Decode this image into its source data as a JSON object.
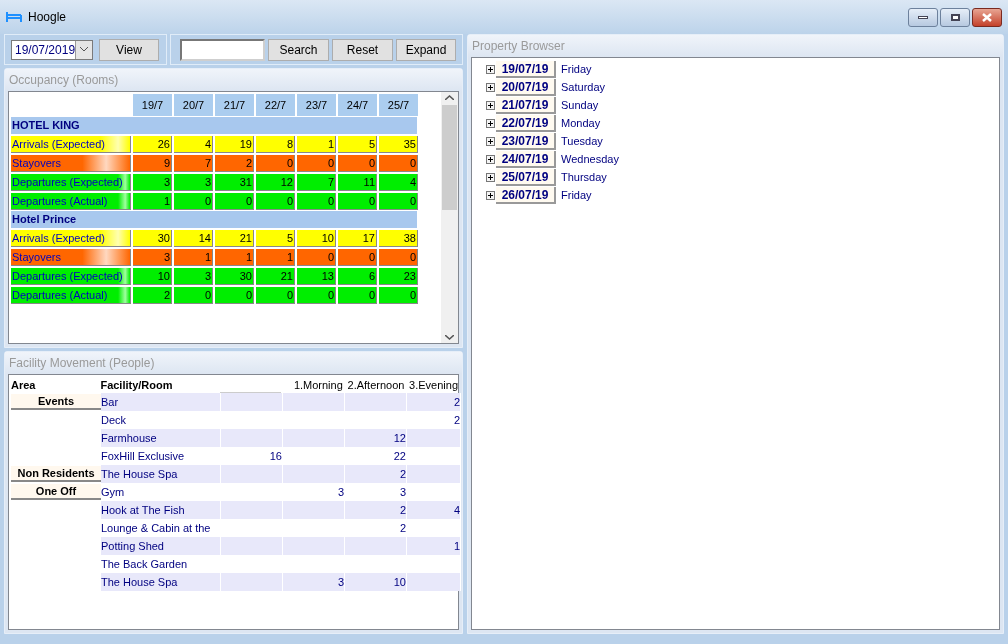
{
  "window": {
    "title": "Hoogle"
  },
  "toolbar": {
    "date": "19/07/2019",
    "view_button": "View",
    "search_button": "Search",
    "reset_button": "Reset",
    "expand_button": "Expand"
  },
  "occupancy": {
    "title": "Occupancy (Rooms)",
    "days": [
      "19/7",
      "20/7",
      "21/7",
      "22/7",
      "23/7",
      "24/7",
      "25/7"
    ],
    "hotels": [
      {
        "name": "HOTEL KING",
        "rows": [
          {
            "kind": "arrivals",
            "label": "Arrivals (Expected)",
            "values": [
              "26",
              "4",
              "19",
              "8",
              "1",
              "5",
              "35"
            ]
          },
          {
            "kind": "stayovers",
            "label": "Stayovers",
            "values": [
              "9",
              "7",
              "2",
              "0",
              "0",
              "0",
              "0"
            ]
          },
          {
            "kind": "departures",
            "label": "Departures (Expected)",
            "values": [
              "3",
              "3",
              "31",
              "12",
              "7",
              "11",
              "4"
            ]
          },
          {
            "kind": "departures",
            "label": "Departures (Actual)",
            "values": [
              "1",
              "0",
              "0",
              "0",
              "0",
              "0",
              "0"
            ]
          }
        ]
      },
      {
        "name": "Hotel Prince",
        "rows": [
          {
            "kind": "arrivals",
            "label": "Arrivals (Expected)",
            "values": [
              "30",
              "14",
              "21",
              "5",
              "10",
              "17",
              "38"
            ]
          },
          {
            "kind": "stayovers",
            "label": "Stayovers",
            "values": [
              "3",
              "1",
              "1",
              "1",
              "0",
              "0",
              "0"
            ]
          },
          {
            "kind": "departures",
            "label": "Departures (Expected)",
            "values": [
              "10",
              "3",
              "30",
              "21",
              "13",
              "6",
              "23"
            ]
          },
          {
            "kind": "departures",
            "label": "Departures (Actual)",
            "values": [
              "2",
              "0",
              "0",
              "0",
              "0",
              "0",
              "0"
            ]
          }
        ]
      }
    ]
  },
  "facility": {
    "title": "Facility Movement (People)",
    "columns": {
      "area": "Area",
      "facility": "Facility/Room",
      "morning": "1.Morning",
      "afternoon": "2.Afternoon",
      "evening": "3.Evening"
    },
    "rows": [
      {
        "area": "Events",
        "facility": "Bar",
        "evening": "2"
      },
      {
        "facility": "Deck",
        "evening": "2"
      },
      {
        "facility": "Farmhouse",
        "afternoon": "12"
      },
      {
        "facility": "FoxHill Exclusive",
        "column_3": "16",
        "afternoon": "22"
      },
      {
        "area": "Non Residents",
        "facility": "The House Spa",
        "afternoon": "2"
      },
      {
        "area": "One Off",
        "facility": "Gym",
        "morning": "3",
        "afternoon": "3"
      },
      {
        "facility": "Hook at The Fish",
        "afternoon": "2",
        "evening": "4"
      },
      {
        "facility": "Lounge & Cabin at the",
        "afternoon": "2"
      },
      {
        "facility": "Potting Shed",
        "evening": "1"
      },
      {
        "facility": "The Back Garden"
      },
      {
        "facility": "The House Spa",
        "morning": "3",
        "afternoon": "10"
      }
    ]
  },
  "property_browser": {
    "title": "Property Browser",
    "items": [
      {
        "date": "19/07/19",
        "day": "Friday",
        "expanded": false
      },
      {
        "date": "20/07/19",
        "day": "Saturday",
        "expanded": false
      },
      {
        "date": "21/07/19",
        "day": "Sunday",
        "expanded": false
      },
      {
        "date": "22/07/19",
        "day": "Monday",
        "expanded": false
      },
      {
        "date": "23/07/19",
        "day": "Tuesday",
        "expanded": false
      },
      {
        "date": "24/07/19",
        "day": "Wednesday",
        "expanded": false
      },
      {
        "date": "25/07/19",
        "day": "Thursday",
        "expanded": false
      },
      {
        "date": "26/07/19",
        "day": "Friday",
        "expanded": false
      }
    ]
  }
}
